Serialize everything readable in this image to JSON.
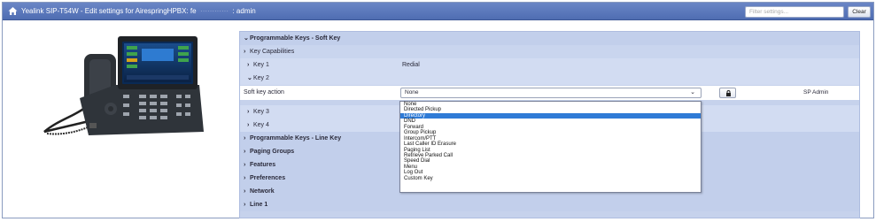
{
  "title_bar": {
    "title": "Yealink SIP-T54W - Edit settings for AirespringHPBX: fe",
    "title_suffix": ": admin",
    "filter_placeholder": "Filter settings...",
    "clear_label": "Clear"
  },
  "settings": {
    "programmable_soft_key": "Programmable Keys - Soft Key",
    "key_capabilities": "Key Capabilities",
    "key1_label": "Key 1",
    "key1_value": "Redial",
    "key2_label": "Key 2",
    "soft_key_action_label": "Soft key action",
    "soft_key_action_value": "None",
    "owner": "SP Admin",
    "key3_label": "Key 3",
    "key4_label": "Key 4",
    "programmable_line_key": "Programmable Keys - Line Key",
    "paging_groups": "Paging Groups",
    "features": "Features",
    "preferences": "Preferences",
    "network": "Network",
    "line1": "Line 1"
  },
  "dropdown_options": [
    "None",
    "Directed Pickup",
    "Directory",
    "DND",
    "Forward",
    "Group Pickup",
    "Intercom/PTT",
    "Last Caller ID Erasure",
    "Paging List",
    "Retrieve Parked Call",
    "Speed Dial",
    "Menu",
    "Log Out",
    "Custom Key"
  ],
  "dropdown_selected": "Directory",
  "icons": {
    "home": "home-icon",
    "expanded": "chevron-down-icon",
    "collapsed": "chevron-right-icon",
    "lock": "lock-icon",
    "caret": "caret-down-icon"
  },
  "colors": {
    "titlebar": "#5674b8",
    "panel": "#c6d2ec",
    "selection": "#2f7bd6"
  }
}
